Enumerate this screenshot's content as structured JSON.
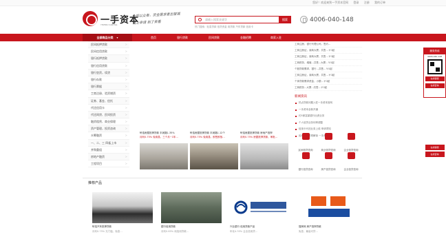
{
  "topbar": {
    "welcome": "您好！欢迎来到一手资本官网",
    "login": "登录",
    "register": "注册",
    "my_order": "我的订单"
  },
  "logo": {
    "name": "一手资本",
    "sub": "YISHOU CAPITAL"
  },
  "slogan": {
    "line1": "全部以众者，资金需求者出智城",
    "line2": "线上申请   到了来看"
  },
  "search": {
    "placeholder": "请输入搜索关键字",
    "button": "搜索",
    "hotwords": "热门搜索：贴息贷款  信贷资金  用贷款  汽车贷款  信用卡"
  },
  "phone": "4006-040-148",
  "nav": {
    "all": "全部商品分类",
    "items": [
      "首页",
      "银行贷款",
      "民间贷款",
      "金融招聘",
      "商家入驻"
    ]
  },
  "sidebar": {
    "items": [
      "民间抵押贷款",
      "民间信用贷款",
      "银行抵押贷款",
      "银行信用贷款",
      "银行垫资，续贷",
      "银行存款",
      "银行票据",
      "工商注册、验资增资",
      "证券、基金、信托",
      "代还信用卡",
      "代还网贷、民间投资",
      "融资租赁、商业保理",
      "资产管理，投资咨询",
      "众筹融资",
      "一、二、三 四板上市",
      "并购重组",
      "房地产融资",
      "工程项目"
    ]
  },
  "rightcol": {
    "lines": [
      "工商注册，银行代理公司，签约...",
      "工商注册证，渝商大厦，共售…￥0起",
      "工商注册证，渝商大厦，共售…￥0起",
      "工商税务，增值...共售...大厦...￥0起",
      "个股贷款需求，银行…共售…￥0起",
      "工商注册证，渝商大厦，共售…￥0起",
      "个体贷款需求资金，小额…￥0起",
      "工商税务...大厦...共售...￥0起"
    ],
    "news_title": "新闻资讯",
    "news": [
      "热点贷款问题入驻一手资本官网",
      "一手资本全新开通",
      "约5家富豪银行出资业务",
      "个人信贷业务利率调整",
      "信用卡代还业务上线 申请须知",
      "民间借贷法规解读 一手资本"
    ]
  },
  "quick": {
    "items": [
      "民间信贷查询",
      "商业信贷查询",
      "企业信贷查询",
      "银行信贷查询",
      "房产信贷查询",
      "企业信贷查询"
    ]
  },
  "cards": [
    {
      "title": "轩浩房屋抵押贷款  丰润路1.35%",
      "sub": "月利0.75%  免用息，三个月~1年…"
    },
    {
      "title": "轩浩房屋抵押贷款  丰润路1.12个",
      "sub": "月利0.75%  免用息，即签即放…"
    },
    {
      "title": "轩浩房屋抵押贷款  房地产抵押",
      "sub": "月利0.75%  房屋抵押贷款，审批…"
    }
  ],
  "recommend": {
    "title": "推荐产品",
    "products": [
      {
        "title": "轩浩汽车抵押贷款",
        "sub": "月利0.75%  无门槛，免息…"
      },
      {
        "title": "银行信用贷款",
        "sub": "月利0.65%  纯信用贷款…"
      },
      {
        "title": "兴业银行 信用贷款产品",
        "sub": "年化4.35%  企业信用贷…"
      },
      {
        "title": "搜房网 房产抵押贷款",
        "sub": "免息，最高可贷…"
      }
    ]
  },
  "float": {
    "header": "服务热线",
    "phone": "4006-040-148",
    "b1": "在线客服",
    "b2": "在线咨询",
    "b3": "在线客服",
    "b4": "在线咨询"
  }
}
